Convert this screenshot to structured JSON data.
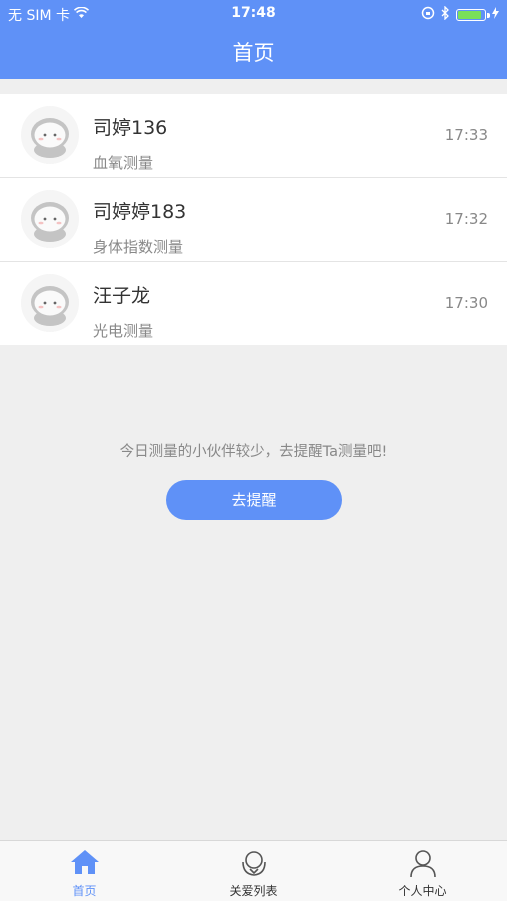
{
  "status_bar": {
    "carrier": "无 SIM 卡",
    "time": "17:48",
    "battery_level": 0.95
  },
  "header": {
    "title": "首页"
  },
  "list": [
    {
      "name": "司婷136",
      "type": "血氧测量",
      "time": "17:33"
    },
    {
      "name": "司婷婷183",
      "type": "身体指数测量",
      "time": "17:32"
    },
    {
      "name": "汪子龙",
      "type": "光电测量",
      "time": "17:30"
    }
  ],
  "tip": "今日测量的小伙伴较少，去提醒Ta测量吧!",
  "remind_button": "去提醒",
  "tabs": [
    {
      "label": "首页",
      "icon": "home-icon",
      "active": true
    },
    {
      "label": "关爱列表",
      "icon": "care-list-icon",
      "active": false
    },
    {
      "label": "个人中心",
      "icon": "person-icon",
      "active": false
    }
  ],
  "colors": {
    "accent": "#5f91f7",
    "background": "#efefef"
  }
}
